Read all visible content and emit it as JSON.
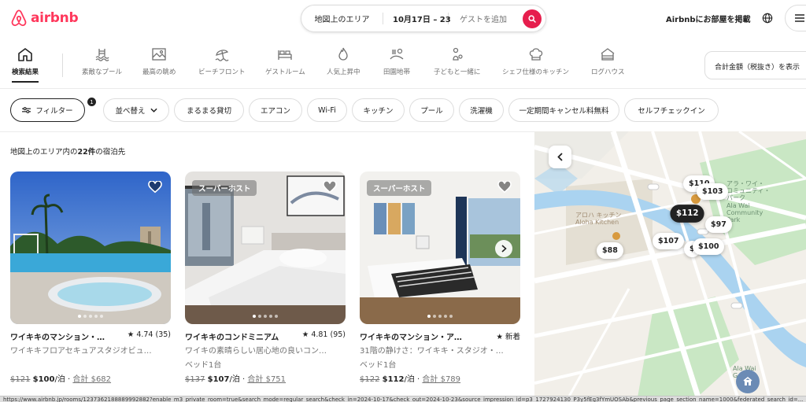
{
  "header": {
    "logo_text": "airbnb",
    "search": {
      "area": "地図上のエリア",
      "dates": "10月17日 – 23",
      "guests_placeholder": "ゲストを追加"
    },
    "host_link": "Airbnbにお部屋を掲載",
    "icons": [
      "airbnb-logo-icon",
      "search-icon",
      "globe-icon",
      "menu-icon"
    ]
  },
  "categories": [
    {
      "label": "検索結果",
      "icon": "house-icon",
      "active": true
    },
    {
      "label": "素敵なプール",
      "icon": "pool-icon"
    },
    {
      "label": "最高の眺め",
      "icon": "view-icon"
    },
    {
      "label": "ビーチフロント",
      "icon": "beach-icon"
    },
    {
      "label": "ゲストルーム",
      "icon": "bed-icon"
    },
    {
      "label": "人気上昇中",
      "icon": "flame-icon"
    },
    {
      "label": "田園地帯",
      "icon": "countryside-icon"
    },
    {
      "label": "子どもと一緒に",
      "icon": "kids-icon"
    },
    {
      "label": "シェフ仕様のキッチン",
      "icon": "chef-hat-icon"
    },
    {
      "label": "ログハウス",
      "icon": "cabin-icon"
    }
  ],
  "tax_toggle_label": "合計金額（税抜き）を表示",
  "filters": {
    "filter_label": "フィルター",
    "filter_badge": "1",
    "sort_label": "並べ替え",
    "chips": [
      "まるまる貸切",
      "エアコン",
      "Wi-Fi",
      "キッチン",
      "プール",
      "洗濯機",
      "一定期間キャンセル料無料",
      "セルフチェックイン"
    ]
  },
  "results": {
    "count_prefix": "地図上のエリア内の",
    "count_number": "22件",
    "count_suffix": "の宿泊先"
  },
  "listings": [
    {
      "title": "ワイキキのマンション・…",
      "rating": "4.74 (35)",
      "subtitle": "ワイキキフロアセキュアスタジオビュ…",
      "beds": "",
      "old_price": "$121",
      "new_price": "$100",
      "per_night": "/泊 ·",
      "total": "合計 $682",
      "superhost": ""
    },
    {
      "title": "ワイキキのコンドミニアム",
      "rating": "4.81 (95)",
      "subtitle": "ワイキの素晴らしい居心地の良いコン…",
      "beds": "ベッド1台",
      "old_price": "$137",
      "new_price": "$107",
      "per_night": "/泊 ·",
      "total": "合計 $751",
      "superhost": "スーパーホスト"
    },
    {
      "title": "ワイキキのマンション・アパ…",
      "rating": "新着",
      "subtitle": "31階の静けさ：ワイキキ・スタジオ・…",
      "beds": "ベッド1台",
      "old_price": "$122",
      "new_price": "$112",
      "per_night": "/泊 ·",
      "total": "合計 $789",
      "superhost": "スーパーホスト"
    }
  ],
  "map": {
    "pins": [
      "$110",
      "$103",
      "$112",
      "$97",
      "$107",
      "$",
      "$100",
      "$88"
    ],
    "labels": {
      "aloha_kitchen_ja": "アロハ キッチン",
      "aloha_kitchen_en": "Aloha Kitchen",
      "park_ja_1": "アラ・ワイ・",
      "park_ja_2": "コミュニティ・",
      "park_ja_3": "パーク",
      "park_en_1": "Ala Wai",
      "park_en_2": "Community",
      "park_en_3": "Park",
      "lower_en_1": "Ala Wai",
      "lower_en_2": "Golf..."
    }
  },
  "status_url": "https://www.airbnb.jp/rooms/1237362188889992882?enable_m3_private_room=true&search_mode=regular_search&check_in=2024-10-17&check_out=2024-10-23&source_impression_id=p3_1727924130_P3y5fEg3fYmUOSAb&previous_page_section_name=1000&federated_search_id=..."
}
